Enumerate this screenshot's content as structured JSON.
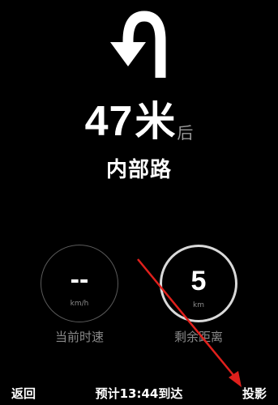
{
  "navigation": {
    "maneuver_icon": "u-turn-left-icon",
    "distance_value": "47",
    "distance_unit": "米",
    "distance_suffix": "后",
    "road_name": "内部路"
  },
  "gauges": {
    "speed": {
      "value": "--",
      "unit": "km/h",
      "label": "当前时速"
    },
    "remaining": {
      "value": "5",
      "unit": "km",
      "label": "剩余距离"
    }
  },
  "bottom_bar": {
    "back_label": "返回",
    "eta_label": "预计13:44到达",
    "project_label": "投影"
  },
  "colors": {
    "background": "#000000",
    "text_primary": "#ffffff",
    "text_secondary": "#8a8a8a",
    "annotation_arrow": "#e0201c"
  },
  "annotation": {
    "icon": "red-arrow-icon"
  }
}
